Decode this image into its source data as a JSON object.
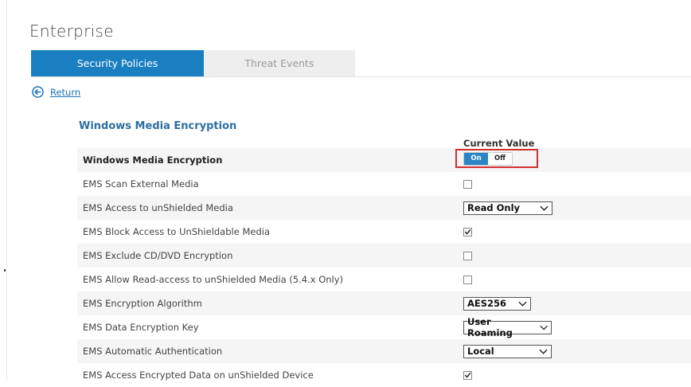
{
  "page": {
    "title": "Enterprise"
  },
  "tabs": [
    {
      "label": "Security Policies",
      "active": true
    },
    {
      "label": "Threat Events",
      "active": false
    }
  ],
  "return_link": {
    "label": "Return",
    "icon": "back-arrow-circle-icon"
  },
  "section": {
    "title": "Windows Media Encryption",
    "column_header": "Current Value"
  },
  "toggle": {
    "on_label": "On",
    "off_label": "Off",
    "selected": "On"
  },
  "rows": [
    {
      "label": "Windows Media Encryption",
      "control": "toggle"
    },
    {
      "label": "EMS Scan External Media",
      "control": "checkbox",
      "checked": false
    },
    {
      "label": "EMS Access to unShielded Media",
      "control": "select",
      "value": "Read Only"
    },
    {
      "label": "EMS Block Access to UnShieldable Media",
      "control": "checkbox",
      "checked": true
    },
    {
      "label": "EMS Exclude CD/DVD Encryption",
      "control": "checkbox",
      "checked": false
    },
    {
      "label": "EMS Allow Read-access to unShielded Media (5.4.x Only)",
      "control": "checkbox",
      "checked": false
    },
    {
      "label": "EMS Encryption Algorithm",
      "control": "select",
      "value": "AES256"
    },
    {
      "label": "EMS Data Encryption Key",
      "control": "select",
      "value": "User Roaming"
    },
    {
      "label": "EMS Automatic Authentication",
      "control": "select",
      "value": "Local"
    },
    {
      "label": "EMS Access Encrypted Data on unShielded Device",
      "control": "checkbox",
      "checked": true
    }
  ],
  "colors": {
    "accent": "#1a7fc1",
    "highlight_border": "#d32f2f",
    "section_title": "#2c6ea1"
  }
}
